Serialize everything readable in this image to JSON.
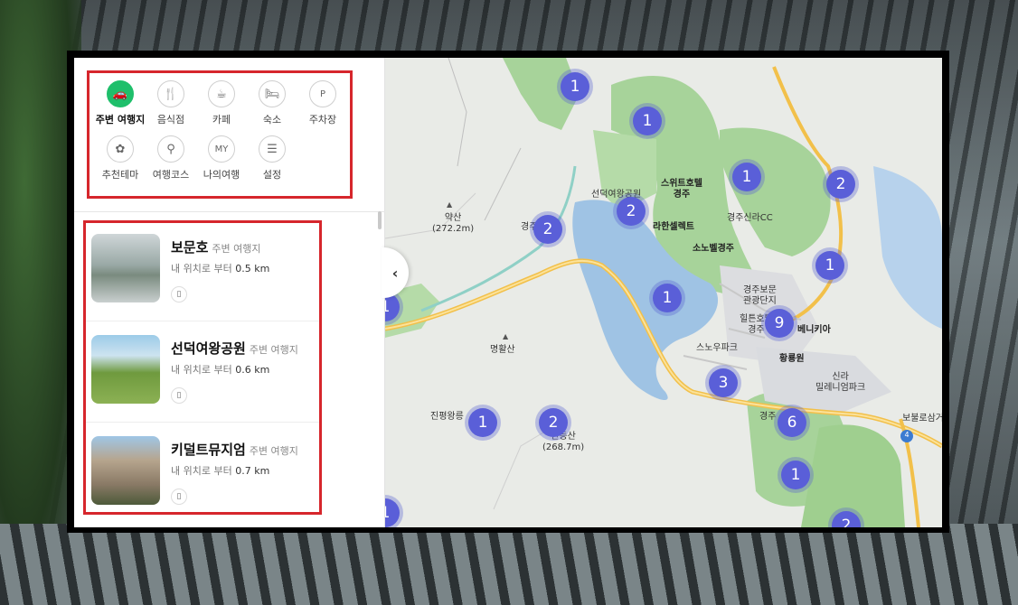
{
  "categories": [
    {
      "label": "주변 여행지",
      "icon": "car-icon",
      "glyph": "🚗",
      "active": true
    },
    {
      "label": "음식점",
      "icon": "restaurant-icon",
      "glyph": "🍴",
      "active": false
    },
    {
      "label": "카페",
      "icon": "coffee-icon",
      "glyph": "☕",
      "active": false
    },
    {
      "label": "숙소",
      "icon": "bed-icon",
      "glyph": "🛏",
      "active": false
    },
    {
      "label": "주차장",
      "icon": "parking-icon",
      "glyph": "P",
      "active": false
    },
    {
      "label": "추천테마",
      "icon": "theme-icon",
      "glyph": "✿",
      "active": false
    },
    {
      "label": "여행코스",
      "icon": "route-icon",
      "glyph": "⚲",
      "active": false
    },
    {
      "label": "나의여행",
      "icon": "my-trip-icon",
      "glyph": "MY",
      "active": false
    },
    {
      "label": "설정",
      "icon": "settings-icon",
      "glyph": "☰",
      "active": false
    }
  ],
  "places": [
    {
      "name": "보문호",
      "type": "주변 여행지",
      "dist_prefix": "내 위치로 부터",
      "dist": "0.5 km"
    },
    {
      "name": "선덕여왕공원",
      "type": "주변 여행지",
      "dist_prefix": "내 위치로 부터",
      "dist": "0.6 km"
    },
    {
      "name": "키덜트뮤지엄",
      "type": "주변 여행지",
      "dist_prefix": "내 위치로 부터",
      "dist": "0.7 km"
    }
  ],
  "map": {
    "clusters": [
      "1",
      "1",
      "1",
      "2",
      "2",
      "2",
      "1",
      "1",
      "1",
      "9",
      "3",
      "1",
      "2",
      "6",
      "1",
      "2",
      "1"
    ],
    "labels": {
      "yaksan": "약산",
      "yaksan_elev": "(272.2m)",
      "myeonghwalsan": "명활산",
      "handeungsan": "한등산",
      "handeungsan_elev": "(268.7m)",
      "suite_hotel": "스위트호텔",
      "suite_hotel_2": "경주",
      "lahan": "라한셀렉트",
      "sonobel": "소노벨경주",
      "gyeongju_shilla_cc": "경주신라CC",
      "bomun_complex": "경주보문",
      "bomun_complex_2": "관광단지",
      "hilton": "힐튼호텔",
      "hilton_2": "경주",
      "benikia": "베니키아",
      "snowpark": "스노우파크",
      "hwangnyongwon": "황룡원",
      "shilla_millennium": "신라",
      "shilla_millennium_2": "밀레니엄파크",
      "jinpyeong": "진평왕릉",
      "bobul": "보불로삼거",
      "route4": "4",
      "seondeok_map": "선덕여왕공원",
      "gyeongju_frag": "경주",
      "gyeongju_frag2": "경주"
    }
  }
}
